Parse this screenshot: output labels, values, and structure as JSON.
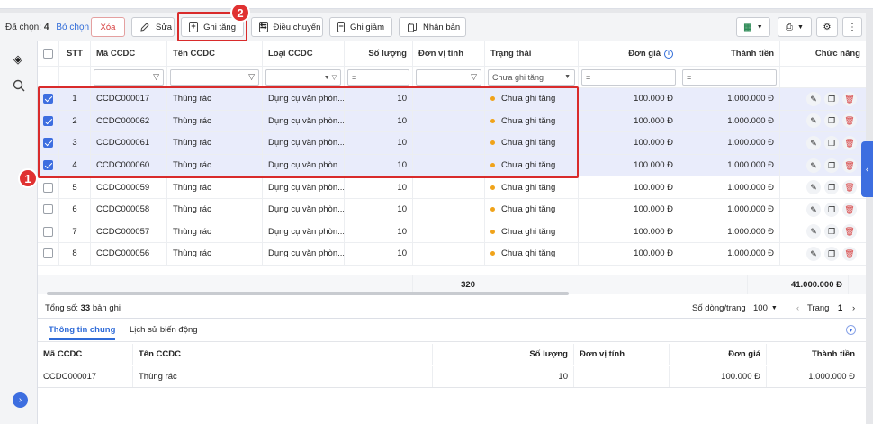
{
  "toolbar": {
    "selected_label": "Đã chọn:",
    "selected_count": "4",
    "deselect": "Bỏ chọn",
    "buttons": {
      "delete": "Xóa",
      "edit": "Sửa",
      "record_increase": "Ghi tăng",
      "transfer": "Điều chuyển",
      "record_decrease": "Ghi giảm",
      "duplicate": "Nhân bản"
    }
  },
  "annotations": {
    "one": "1",
    "two": "2"
  },
  "grid": {
    "headers": {
      "stt": "STT",
      "code": "Mã CCDC",
      "name": "Tên CCDC",
      "type": "Loại CCDC",
      "qty": "Số lượng",
      "unit": "Đơn vị tính",
      "status": "Trạng thái",
      "price": "Đơn giá",
      "total": "Thành tiền",
      "actions": "Chức năng"
    },
    "filters": {
      "status": "Chưa ghi tăng",
      "eq": "="
    },
    "rows": [
      {
        "stt": "1",
        "code": "CCDC000017",
        "name": "Thùng rác",
        "type": "Dụng cụ văn phòn...",
        "qty": "10",
        "status": "Chưa ghi tăng",
        "price": "100.000 Đ",
        "total": "1.000.000 Đ",
        "checked": true
      },
      {
        "stt": "2",
        "code": "CCDC000062",
        "name": "Thùng rác",
        "type": "Dụng cụ văn phòn...",
        "qty": "10",
        "status": "Chưa ghi tăng",
        "price": "100.000 Đ",
        "total": "1.000.000 Đ",
        "checked": true
      },
      {
        "stt": "3",
        "code": "CCDC000061",
        "name": "Thùng rác",
        "type": "Dụng cụ văn phòn...",
        "qty": "10",
        "status": "Chưa ghi tăng",
        "price": "100.000 Đ",
        "total": "1.000.000 Đ",
        "checked": true
      },
      {
        "stt": "4",
        "code": "CCDC000060",
        "name": "Thùng rác",
        "type": "Dụng cụ văn phòn...",
        "qty": "10",
        "status": "Chưa ghi tăng",
        "price": "100.000 Đ",
        "total": "1.000.000 Đ",
        "checked": true
      },
      {
        "stt": "5",
        "code": "CCDC000059",
        "name": "Thùng rác",
        "type": "Dụng cụ văn phòn...",
        "qty": "10",
        "status": "Chưa ghi tăng",
        "price": "100.000 Đ",
        "total": "1.000.000 Đ",
        "checked": false
      },
      {
        "stt": "6",
        "code": "CCDC000058",
        "name": "Thùng rác",
        "type": "Dụng cụ văn phòn...",
        "qty": "10",
        "status": "Chưa ghi tăng",
        "price": "100.000 Đ",
        "total": "1.000.000 Đ",
        "checked": false
      },
      {
        "stt": "7",
        "code": "CCDC000057",
        "name": "Thùng rác",
        "type": "Dụng cụ văn phòn...",
        "qty": "10",
        "status": "Chưa ghi tăng",
        "price": "100.000 Đ",
        "total": "1.000.000 Đ",
        "checked": false
      },
      {
        "stt": "8",
        "code": "CCDC000056",
        "name": "Thùng rác",
        "type": "Dụng cụ văn phòn...",
        "qty": "10",
        "status": "Chưa ghi tăng",
        "price": "100.000 Đ",
        "total": "1.000.000 Đ",
        "checked": false
      }
    ],
    "footer": {
      "qty": "320",
      "total": "41.000.000 Đ"
    }
  },
  "pager": {
    "total_label": "Tổng số:",
    "total_count": "33",
    "total_suffix": "bản ghi",
    "rows_per_page_label": "Số dòng/trang",
    "rows_per_page": "100",
    "page_label": "Trang",
    "page": "1"
  },
  "detail": {
    "tabs": [
      "Thông tin chung",
      "Lịch sử biến động"
    ],
    "headers": {
      "code": "Mã CCDC",
      "name": "Tên CCDC",
      "qty": "Số lượng",
      "unit": "Đơn vị tính",
      "price": "Đơn giá",
      "total": "Thành tiền"
    },
    "row": {
      "code": "CCDC000017",
      "name": "Thùng rác",
      "qty": "10",
      "unit": "",
      "price": "100.000 Đ",
      "total": "1.000.000 Đ"
    }
  },
  "colors": {
    "accent": "#2f6bd8",
    "highlight": "#d92b2b",
    "status_dot": "#f0a31a",
    "selected_row": "#e9ecfb"
  }
}
